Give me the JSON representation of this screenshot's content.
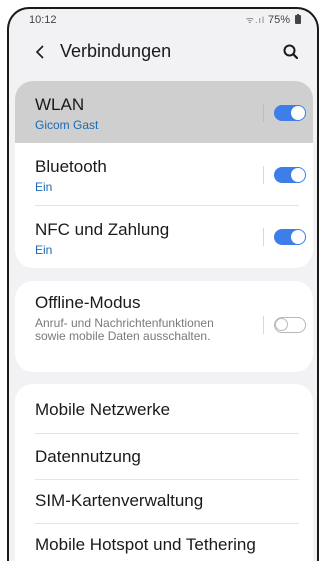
{
  "status_bar": {
    "time": "10:12",
    "signal_icons": "ᯤ.ıl",
    "battery": "75%"
  },
  "header": {
    "title": "Verbindungen"
  },
  "connections": [
    {
      "title": "WLAN",
      "subtitle": "Gicom Gast",
      "toggle_on": true,
      "highlighted": true
    },
    {
      "title": "Bluetooth",
      "subtitle": "Ein",
      "toggle_on": true,
      "highlighted": false
    },
    {
      "title": "NFC und Zahlung",
      "subtitle": "Ein",
      "toggle_on": true,
      "highlighted": false
    }
  ],
  "offline": {
    "title": "Offline-Modus",
    "description": "Anruf- und Nachrichtenfunktionen sowie mobile Daten ausschalten.",
    "toggle_on": false
  },
  "menu": [
    "Mobile Netzwerke",
    "Datennutzung",
    "SIM-Kartenverwaltung",
    "Mobile Hotspot und Tethering"
  ],
  "colors": {
    "accent": "#3e7ee8",
    "subtitle": "#1b6ab3",
    "highlight": "#cfcfcf",
    "background": "#f2f2f4"
  }
}
